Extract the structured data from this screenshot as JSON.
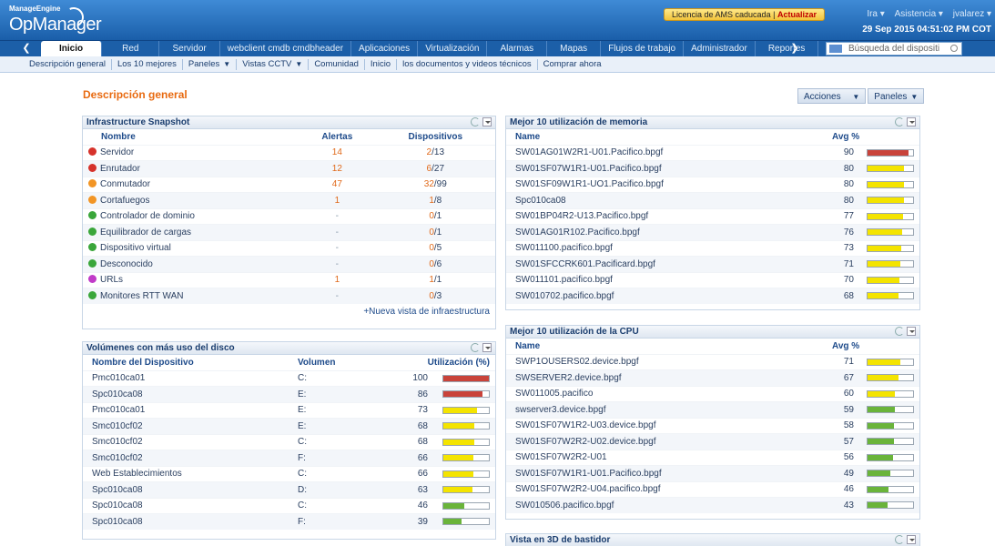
{
  "header": {
    "brand_small": "ManageEngine",
    "brand_main": "OpManager",
    "license_text": "Licencia de AMS caducada",
    "license_update": "Actualizar",
    "user_links": [
      "Ira ▾",
      "Asistencia ▾",
      "jvalarez ▾"
    ],
    "datetime": "29 Sep 2015 04:51:02 PM COT"
  },
  "nav": {
    "prev_arrow": "❮",
    "next_arrow": "❯",
    "tabs": [
      "Inicio",
      "Red",
      "Servidor",
      "webclient cmdb cmdbheader",
      "Aplicaciones",
      "Virtualización",
      "Alarmas",
      "Mapas",
      "Flujos de trabajo",
      "Administrador",
      "Reportes"
    ],
    "search_placeholder": "Búsqueda del dispositi"
  },
  "subnav": {
    "items": [
      "Descripción general",
      "Los 10 mejores",
      "Paneles",
      "Vistas CCTV",
      "Comunidad",
      "Inicio",
      "los documentos y videos técnicos",
      "Comprar ahora"
    ]
  },
  "page": {
    "title": "Descripción general",
    "actions_label": "Acciones",
    "panels_label": "Paneles"
  },
  "snapshot": {
    "title": "Infrastructure Snapshot",
    "col_name": "Nombre",
    "col_alerts": "Alertas",
    "col_devices": "Dispositivos",
    "rows": [
      {
        "name": "Servidor",
        "status": "critical",
        "alerts": "14",
        "devices": "2",
        "total": "/13"
      },
      {
        "name": "Enrutador",
        "status": "critical",
        "alerts": "12",
        "devices": "6",
        "total": "/27"
      },
      {
        "name": "Conmutador",
        "status": "major",
        "alerts": "47",
        "devices": "32",
        "total": "/99"
      },
      {
        "name": "Cortafuegos",
        "status": "major",
        "alerts": "1",
        "devices": "1",
        "total": "/8"
      },
      {
        "name": "Controlador de dominio",
        "status": "clear",
        "alerts": "-",
        "devices": "0",
        "total": "/1"
      },
      {
        "name": "Equilibrador de cargas",
        "status": "clear",
        "alerts": "-",
        "devices": "0",
        "total": "/1"
      },
      {
        "name": "Dispositivo virtual",
        "status": "clear",
        "alerts": "-",
        "devices": "0",
        "total": "/5"
      },
      {
        "name": "Desconocido",
        "status": "clear",
        "alerts": "-",
        "devices": "0",
        "total": "/6"
      },
      {
        "name": "URLs",
        "status": "attention",
        "alerts": "1",
        "devices": "1",
        "total": "/1"
      },
      {
        "name": "Monitores RTT WAN",
        "status": "clear",
        "alerts": "-",
        "devices": "0",
        "total": "/3"
      }
    ],
    "footer_link": "+Nueva vista de infraestructura"
  },
  "disk": {
    "title": "Volúmenes con más uso del disco",
    "col_device": "Nombre del Dispositivo",
    "col_volume": "Volumen",
    "col_util": "Utilización (%)",
    "rows": [
      {
        "device": "Pmc010ca01",
        "volume": "C:",
        "util": 100
      },
      {
        "device": "Spc010ca08",
        "volume": "E:",
        "util": 86
      },
      {
        "device": "Pmc010ca01",
        "volume": "E:",
        "util": 73
      },
      {
        "device": "Smc010cf02",
        "volume": "E:",
        "util": 68
      },
      {
        "device": "Smc010cf02",
        "volume": "C:",
        "util": 68
      },
      {
        "device": "Smc010cf02",
        "volume": "F:",
        "util": 66
      },
      {
        "device": "Web Establecimientos",
        "volume": "C:",
        "util": 66
      },
      {
        "device": "Spc010ca08",
        "volume": "D:",
        "util": 63
      },
      {
        "device": "Spc010ca08",
        "volume": "C:",
        "util": 46
      },
      {
        "device": "Spc010ca08",
        "volume": "F:",
        "util": 39
      }
    ]
  },
  "memory": {
    "title": "Mejor 10 utilización de memoria",
    "col_name": "Name",
    "col_avg": "Avg %",
    "rows": [
      {
        "name": "SW01AG01W2R1-U01.Pacifico.bpgf",
        "avg": 90
      },
      {
        "name": "SW01SF07W1R1-U01.Pacifico.bpgf",
        "avg": 80
      },
      {
        "name": "SW01SF09W1R1-UO1.Pacifico.bpgf",
        "avg": 80
      },
      {
        "name": "Spc010ca08",
        "avg": 80
      },
      {
        "name": "SW01BP04R2-U13.Pacifico.bpgf",
        "avg": 77
      },
      {
        "name": "SW01AG01R102.Pacifico.bpgf",
        "avg": 76
      },
      {
        "name": "SW011100.pacifico.bpgf",
        "avg": 73
      },
      {
        "name": "SW01SFCCRK601.Pacificard.bpgf",
        "avg": 71
      },
      {
        "name": "SW011101.pacifico.bpgf",
        "avg": 70
      },
      {
        "name": "SW010702.pacifico.bpgf",
        "avg": 68
      }
    ]
  },
  "cpu": {
    "title": "Mejor 10 utilización de la CPU",
    "col_name": "Name",
    "col_avg": "Avg %",
    "rows": [
      {
        "name": "SWP1OUSERS02.device.bpgf",
        "avg": 71
      },
      {
        "name": "SWSERVER2.device.bpgf",
        "avg": 67
      },
      {
        "name": "SW011005.pacifico",
        "avg": 60
      },
      {
        "name": "swserver3.device.bpgf",
        "avg": 59
      },
      {
        "name": "SW01SF07W1R2-U03.device.bpgf",
        "avg": 58
      },
      {
        "name": "SW01SF07W2R2-U02.device.bpgf",
        "avg": 57
      },
      {
        "name": "SW01SF07W2R2-U01",
        "avg": 56
      },
      {
        "name": "SW01SF07W1R1-U01.Pacifico.bpgf",
        "avg": 49
      },
      {
        "name": "SW01SF07W2R2-U04.pacifico.bpgf",
        "avg": 46
      },
      {
        "name": "SW010506.pacifico.bpgf",
        "avg": 43
      }
    ]
  },
  "rack": {
    "title": "Vista en 3D de bastidor"
  },
  "colors": {
    "critical": "#d6322b",
    "major": "#f29525",
    "clear": "#3aa63a",
    "attention": "#c13ac8",
    "bar_red": "#c9433a",
    "bar_yellow": "#f4e400",
    "bar_green": "#6ab43a",
    "accent": "#e86a10"
  }
}
